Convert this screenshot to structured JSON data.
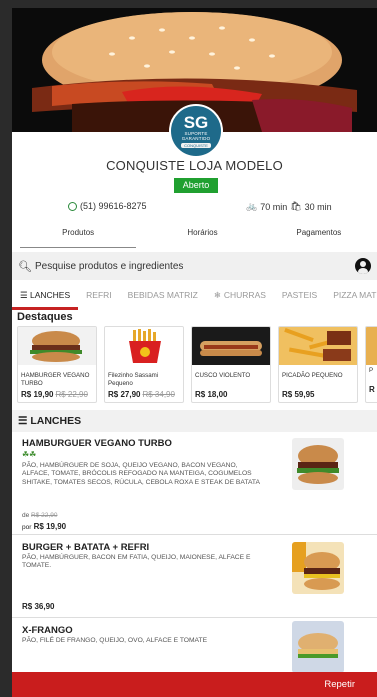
{
  "store": {
    "logo_initials": "SG",
    "logo_line1": "SUPORTE",
    "logo_line2": "GARANTIDO",
    "logo_band": "CONQUISTE",
    "name": "CONQUISTE LOJA MODELO",
    "status": "Aberto",
    "phone": "(51) 99616-8275",
    "delivery_time": "70 min",
    "pickup_time": "30 min"
  },
  "tabs": [
    "Produtos",
    "Horários",
    "Pagamentos"
  ],
  "search": {
    "placeholder": "Pesquise produtos e ingredientes"
  },
  "categories": [
    "LANCHES",
    "REFRI",
    "BEBIDAS MATRIZ",
    "CHURRAS",
    "PASTEIS",
    "PIZZA MATRI"
  ],
  "highlights": {
    "title": "Destaques",
    "items": [
      {
        "name": "HAMBURGER VEGANO TURBO",
        "price": "R$ 19,90",
        "old_price": "R$ 22,90"
      },
      {
        "name": "Filezinho Sassami Pequeno",
        "price": "R$ 27,90",
        "old_price": "R$ 34,90"
      },
      {
        "name": "CUSCO VIOLENTO",
        "price": "R$ 18,00",
        "old_price": ""
      },
      {
        "name": "PICADÃO PEQUENO",
        "price": "R$ 59,95",
        "old_price": ""
      },
      {
        "name": "P",
        "price": "R",
        "old_price": ""
      }
    ]
  },
  "menu": {
    "group_title": "LANCHES",
    "items": [
      {
        "title": "HAMBURGUER VEGANO TURBO",
        "description": "PÃO, HAMBÚRGUER DE SOJA, QUEIJO VEGANO, BACON VEGANO, ALFACE, TOMATE, BRÓCOLIS REFOGADO NA MANTEIGA, COGUMELOS SHITAKE, TOMATES SECOS, RÚCULA, CEBOLA ROXA E STEAK DE BATATA",
        "de_label": "de",
        "old_price": "R$ 22,90",
        "por_label": "por",
        "price": "R$ 19,90"
      },
      {
        "title": "BURGER + BATATA + REFRI",
        "description": "PÃO, HAMBÚRGUER, BACON EM FATIA, QUEIJO, MAIONESE, ALFACE E TOMATE.",
        "price": "R$ 36,90"
      },
      {
        "title": "X-FRANGO",
        "description": "PÃO, FILÉ DE FRANGO, QUEIJO, OVO, ALFACE E TOMATE"
      }
    ]
  },
  "cta": {
    "label": "Repetir"
  },
  "colors": {
    "brand_red": "#c91d1d",
    "status_green": "#20a030",
    "logo_blue": "#1e6a8a"
  }
}
